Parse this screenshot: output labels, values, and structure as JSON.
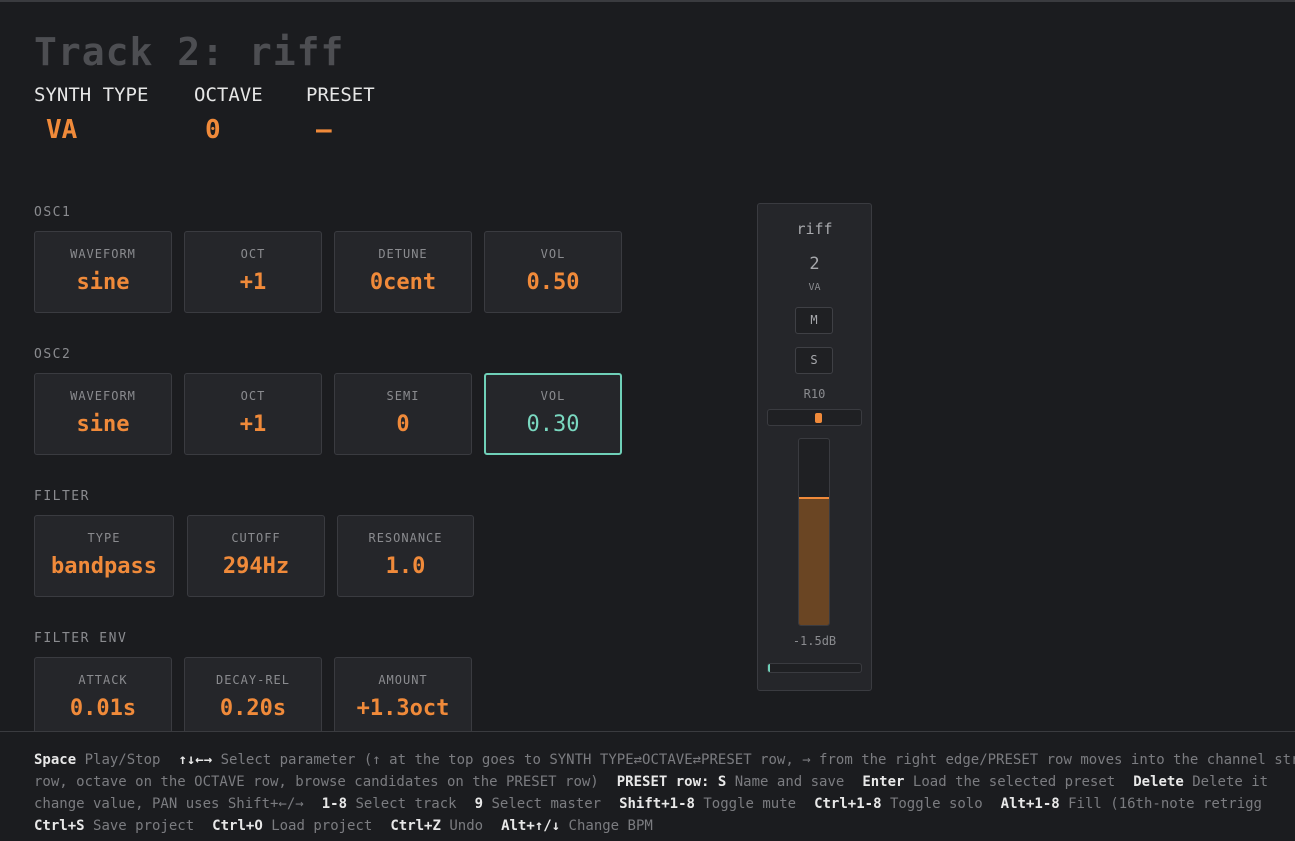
{
  "header": {
    "title": "Track 2: riff",
    "synth_type_label": "SYNTH TYPE",
    "synth_type_value": "VA",
    "octave_label": "OCTAVE",
    "octave_value": "0",
    "preset_label": "PRESET",
    "preset_value": "—"
  },
  "osc1": {
    "label": "OSC1",
    "params": [
      {
        "label": "WAVEFORM",
        "value": "sine"
      },
      {
        "label": "OCT",
        "value": "+1"
      },
      {
        "label": "DETUNE",
        "value": "0cent"
      },
      {
        "label": "VOL",
        "value": "0.50"
      }
    ]
  },
  "osc2": {
    "label": "OSC2",
    "params": [
      {
        "label": "WAVEFORM",
        "value": "sine"
      },
      {
        "label": "OCT",
        "value": "+1"
      },
      {
        "label": "SEMI",
        "value": "0"
      },
      {
        "label": "VOL",
        "value": "0.30",
        "selected": true
      }
    ]
  },
  "filter": {
    "label": "FILTER",
    "params": [
      {
        "label": "TYPE",
        "value": "bandpass"
      },
      {
        "label": "CUTOFF",
        "value": "294Hz"
      },
      {
        "label": "RESONANCE",
        "value": "1.0"
      }
    ]
  },
  "filter_env": {
    "label": "FILTER ENV",
    "params": [
      {
        "label": "ATTACK",
        "value": "0.01s"
      },
      {
        "label": "DECAY-REL",
        "value": "0.20s"
      },
      {
        "label": "AMOUNT",
        "value": "+1.3oct"
      }
    ]
  },
  "channel_strip": {
    "name": "riff",
    "number": "2",
    "type": "VA",
    "mute_label": "M",
    "solo_label": "S",
    "pan_label": "R10",
    "pan_fraction": 0.55,
    "fader_level_fraction": 0.69,
    "volume_db": "-1.5dB",
    "meter_level_fraction": 0.02,
    "accent_color": "#f08a3a",
    "selection_color": "#6fd0b8"
  },
  "help": {
    "line1": [
      {
        "key": "Space",
        "text": "Play/Stop"
      },
      {
        "key": "↑↓←→",
        "text": "Select parameter (↑ at the top goes to SYNTH TYPE⇄OCTAVE⇄PRESET row, → from the right edge/PRESET row moves into the channel str"
      }
    ],
    "line2": [
      {
        "key": "",
        "text": "row, octave on the OCTAVE row, browse candidates on the PRESET row)"
      },
      {
        "key": "PRESET row: S",
        "text": "Name and save"
      },
      {
        "key": "Enter",
        "text": "Load the selected preset"
      },
      {
        "key": "Delete",
        "text": "Delete it"
      }
    ],
    "line3": [
      {
        "key": "",
        "text": "change value, PAN uses Shift+←/→"
      },
      {
        "key": "1-8",
        "text": "Select track"
      },
      {
        "key": "9",
        "text": "Select master"
      },
      {
        "key": "Shift+1-8",
        "text": "Toggle mute"
      },
      {
        "key": "Ctrl+1-8",
        "text": "Toggle solo"
      },
      {
        "key": "Alt+1-8",
        "text": "Fill (16th-note retrigg"
      }
    ],
    "line4": [
      {
        "key": "Ctrl+S",
        "text": "Save project"
      },
      {
        "key": "Ctrl+O",
        "text": "Load project"
      },
      {
        "key": "Ctrl+Z",
        "text": "Undo"
      },
      {
        "key": "Alt+↑/↓",
        "text": "Change BPM"
      }
    ]
  }
}
